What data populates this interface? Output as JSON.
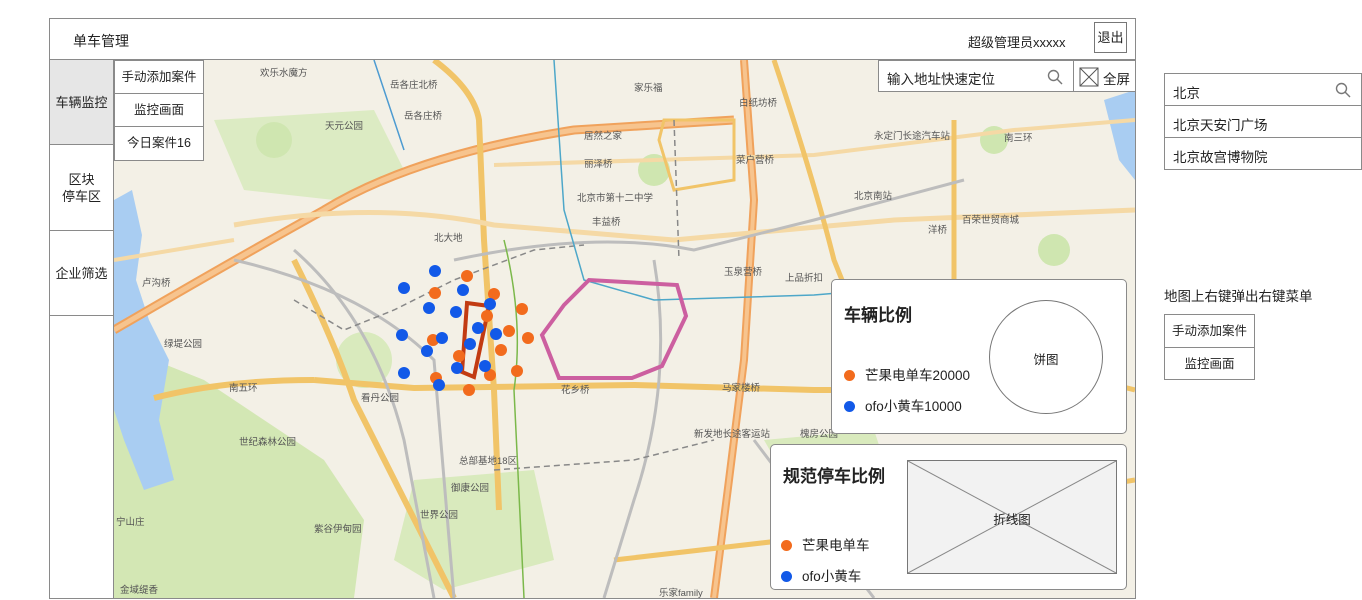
{
  "header": {
    "app_title": "单车管理",
    "user_label": "超级管理员xxxxx",
    "logout_label": "退出"
  },
  "leftnav": {
    "items": [
      {
        "label": "车辆监控"
      },
      {
        "label": "区块\n停车区"
      },
      {
        "label": "企业筛选"
      }
    ]
  },
  "submenu": {
    "items": [
      {
        "label": "手动添加案件"
      },
      {
        "label": "监控画面"
      },
      {
        "label": "今日案件16"
      }
    ]
  },
  "map_search": {
    "placeholder": "输入地址快速定位",
    "fullscreen_label": "全屏"
  },
  "map_labels": [
    "欢乐水魔方",
    "岳各庄北桥",
    "岳各庄桥",
    "天元公园",
    "家乐福",
    "居然之家",
    "白纸坊桥",
    "丽泽桥",
    "菜户营桥",
    "北京市第十二中学",
    "丰益桥",
    "北京南站",
    "百荣世贸商城",
    "洋桥",
    "北大地",
    "花乡桥",
    "马家楼桥",
    "总部基地18区",
    "御康公园",
    "世界公园",
    "紫谷伊甸园",
    "世纪森林公园",
    "看丹公园",
    "绿堤公园",
    "卢沟桥",
    "金域缇香",
    "宁山庄",
    "永定门长途汽车站",
    "南三环",
    "南五环",
    "新发地长途客运站",
    "槐房公园",
    "乐家family",
    "上品折扣",
    "玉泉营桥"
  ],
  "vehicle_ratio_card": {
    "title": "车辆比例",
    "pie_label": "饼图",
    "legend": [
      {
        "label": "芒果电单车20000",
        "color": "#f26b1d"
      },
      {
        "label": "ofo小黄车10000",
        "color": "#1259e8"
      }
    ]
  },
  "parking_ratio_card": {
    "title": "规范停车比例",
    "line_label": "折线图",
    "legend": [
      {
        "label": "芒果电单车",
        "color": "#f26b1d"
      },
      {
        "label": "ofo小黄车",
        "color": "#1259e8"
      }
    ]
  },
  "right_panel": {
    "search_value": "北京",
    "results": [
      "北京天安门广场",
      "北京故宫博物院"
    ],
    "note": "地图上右键弹出右键菜单",
    "context_menu": [
      "手动添加案件",
      "监控画面"
    ]
  },
  "colors": {
    "orange_marker": "#f26b1d",
    "blue_marker": "#1259e8",
    "zone_polygon": "#cc5fa0",
    "selection_polygon": "#c23b12"
  }
}
